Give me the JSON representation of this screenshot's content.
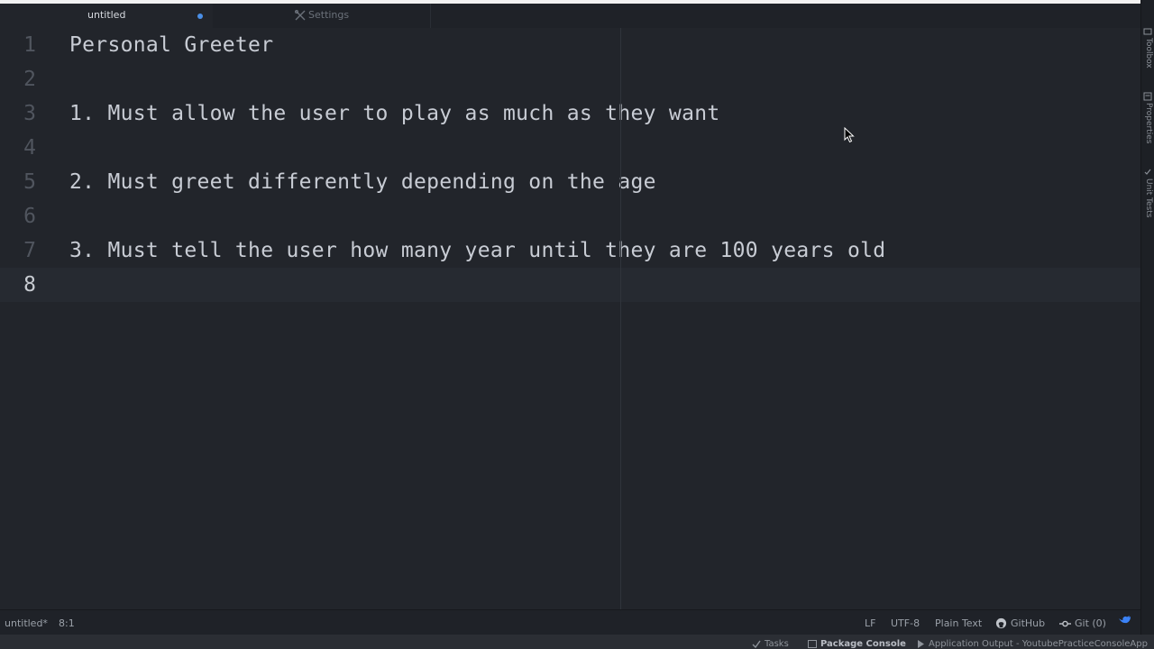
{
  "tabs": [
    {
      "label": "untitled",
      "modified": true
    },
    {
      "label": "Settings",
      "icon": "settings-icon"
    }
  ],
  "editor": {
    "lines": [
      {
        "number": "1",
        "text": "Personal Greeter"
      },
      {
        "number": "2",
        "text": ""
      },
      {
        "number": "3",
        "text": "1. Must allow the user to play as much as they want"
      },
      {
        "number": "4",
        "text": ""
      },
      {
        "number": "5",
        "text": "2. Must greet differently depending on the age"
      },
      {
        "number": "6",
        "text": ""
      },
      {
        "number": "7",
        "text": "3. Must tell the user how many year until they are 100 years old"
      },
      {
        "number": "8",
        "text": ""
      }
    ],
    "cursor_line": 8
  },
  "right_panel": {
    "tabs": [
      "Toolbox",
      "Properties",
      "Unit Tests"
    ]
  },
  "status": {
    "file": "untitled*",
    "position": "8:1",
    "line_ending": "LF",
    "encoding": "UTF-8",
    "grammar": "Plain Text",
    "github": "GitHub",
    "git": "Git (0)"
  },
  "bottom_pads": {
    "tasks": "Tasks",
    "package_console": "Package Console",
    "app_output": "Application Output - YoutubePracticeConsoleApp"
  },
  "colors": {
    "background": "#22252b",
    "accent": "#4a8fe7",
    "text": "#c8ccd4"
  }
}
